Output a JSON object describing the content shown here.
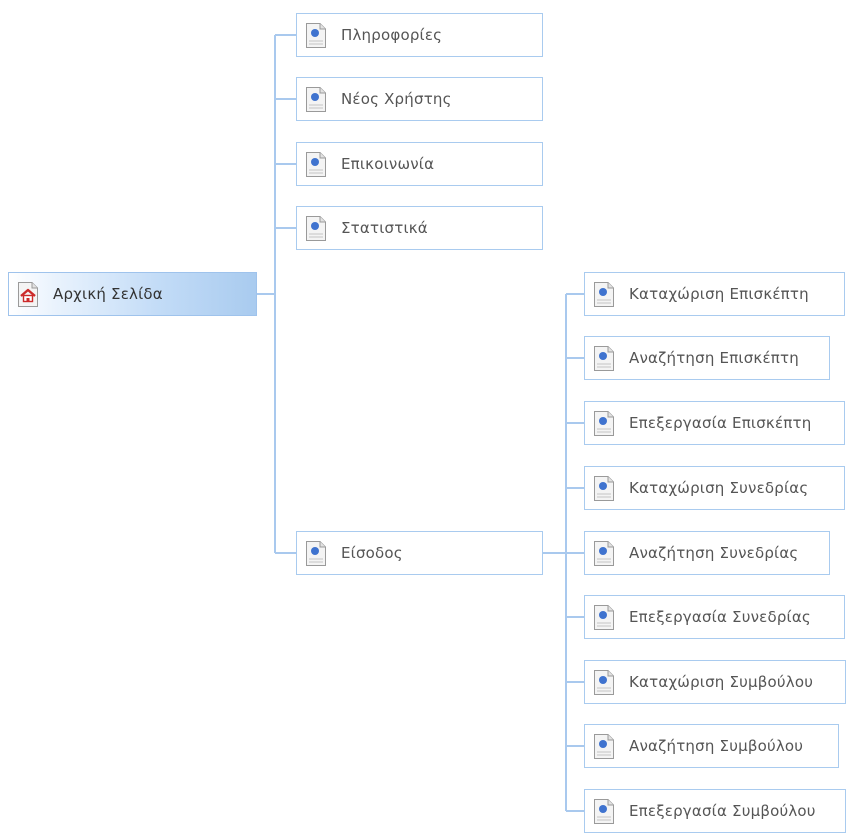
{
  "root": {
    "label": "Αρχική Σελίδα",
    "icon": "home-page-icon"
  },
  "level1": [
    {
      "label": "Πληροφορίες",
      "icon": "page-icon"
    },
    {
      "label": "Νέος Χρήστης",
      "icon": "page-icon"
    },
    {
      "label": "Επικοινωνία",
      "icon": "page-icon"
    },
    {
      "label": "Στατιστικά",
      "icon": "page-icon"
    },
    {
      "label": "Είσοδος",
      "icon": "page-icon"
    }
  ],
  "level2": [
    {
      "label": "Καταχώριση Επισκέπτη",
      "icon": "page-icon"
    },
    {
      "label": "Αναζήτηση Επισκέπτη",
      "icon": "page-icon"
    },
    {
      "label": "Επεξεργασία Επισκέπτη",
      "icon": "page-icon"
    },
    {
      "label": "Καταχώριση Συνεδρίας",
      "icon": "page-icon"
    },
    {
      "label": "Αναζήτηση Συνεδρίας",
      "icon": "page-icon"
    },
    {
      "label": "Επεξεργασία Συνεδρίας",
      "icon": "page-icon"
    },
    {
      "label": "Καταχώριση Συμβούλου",
      "icon": "page-icon"
    },
    {
      "label": "Αναζήτηση Συμβούλου",
      "icon": "page-icon"
    },
    {
      "label": "Επεξεργασία Συμβούλου",
      "icon": "page-icon"
    }
  ],
  "colors": {
    "connector": "#a9c9ee",
    "node_border": "#a9cbef",
    "root_gradient_end": "#a9cbef",
    "page_icon_dot": "#3f73cf",
    "home_icon_roof": "#cc2a2a"
  }
}
